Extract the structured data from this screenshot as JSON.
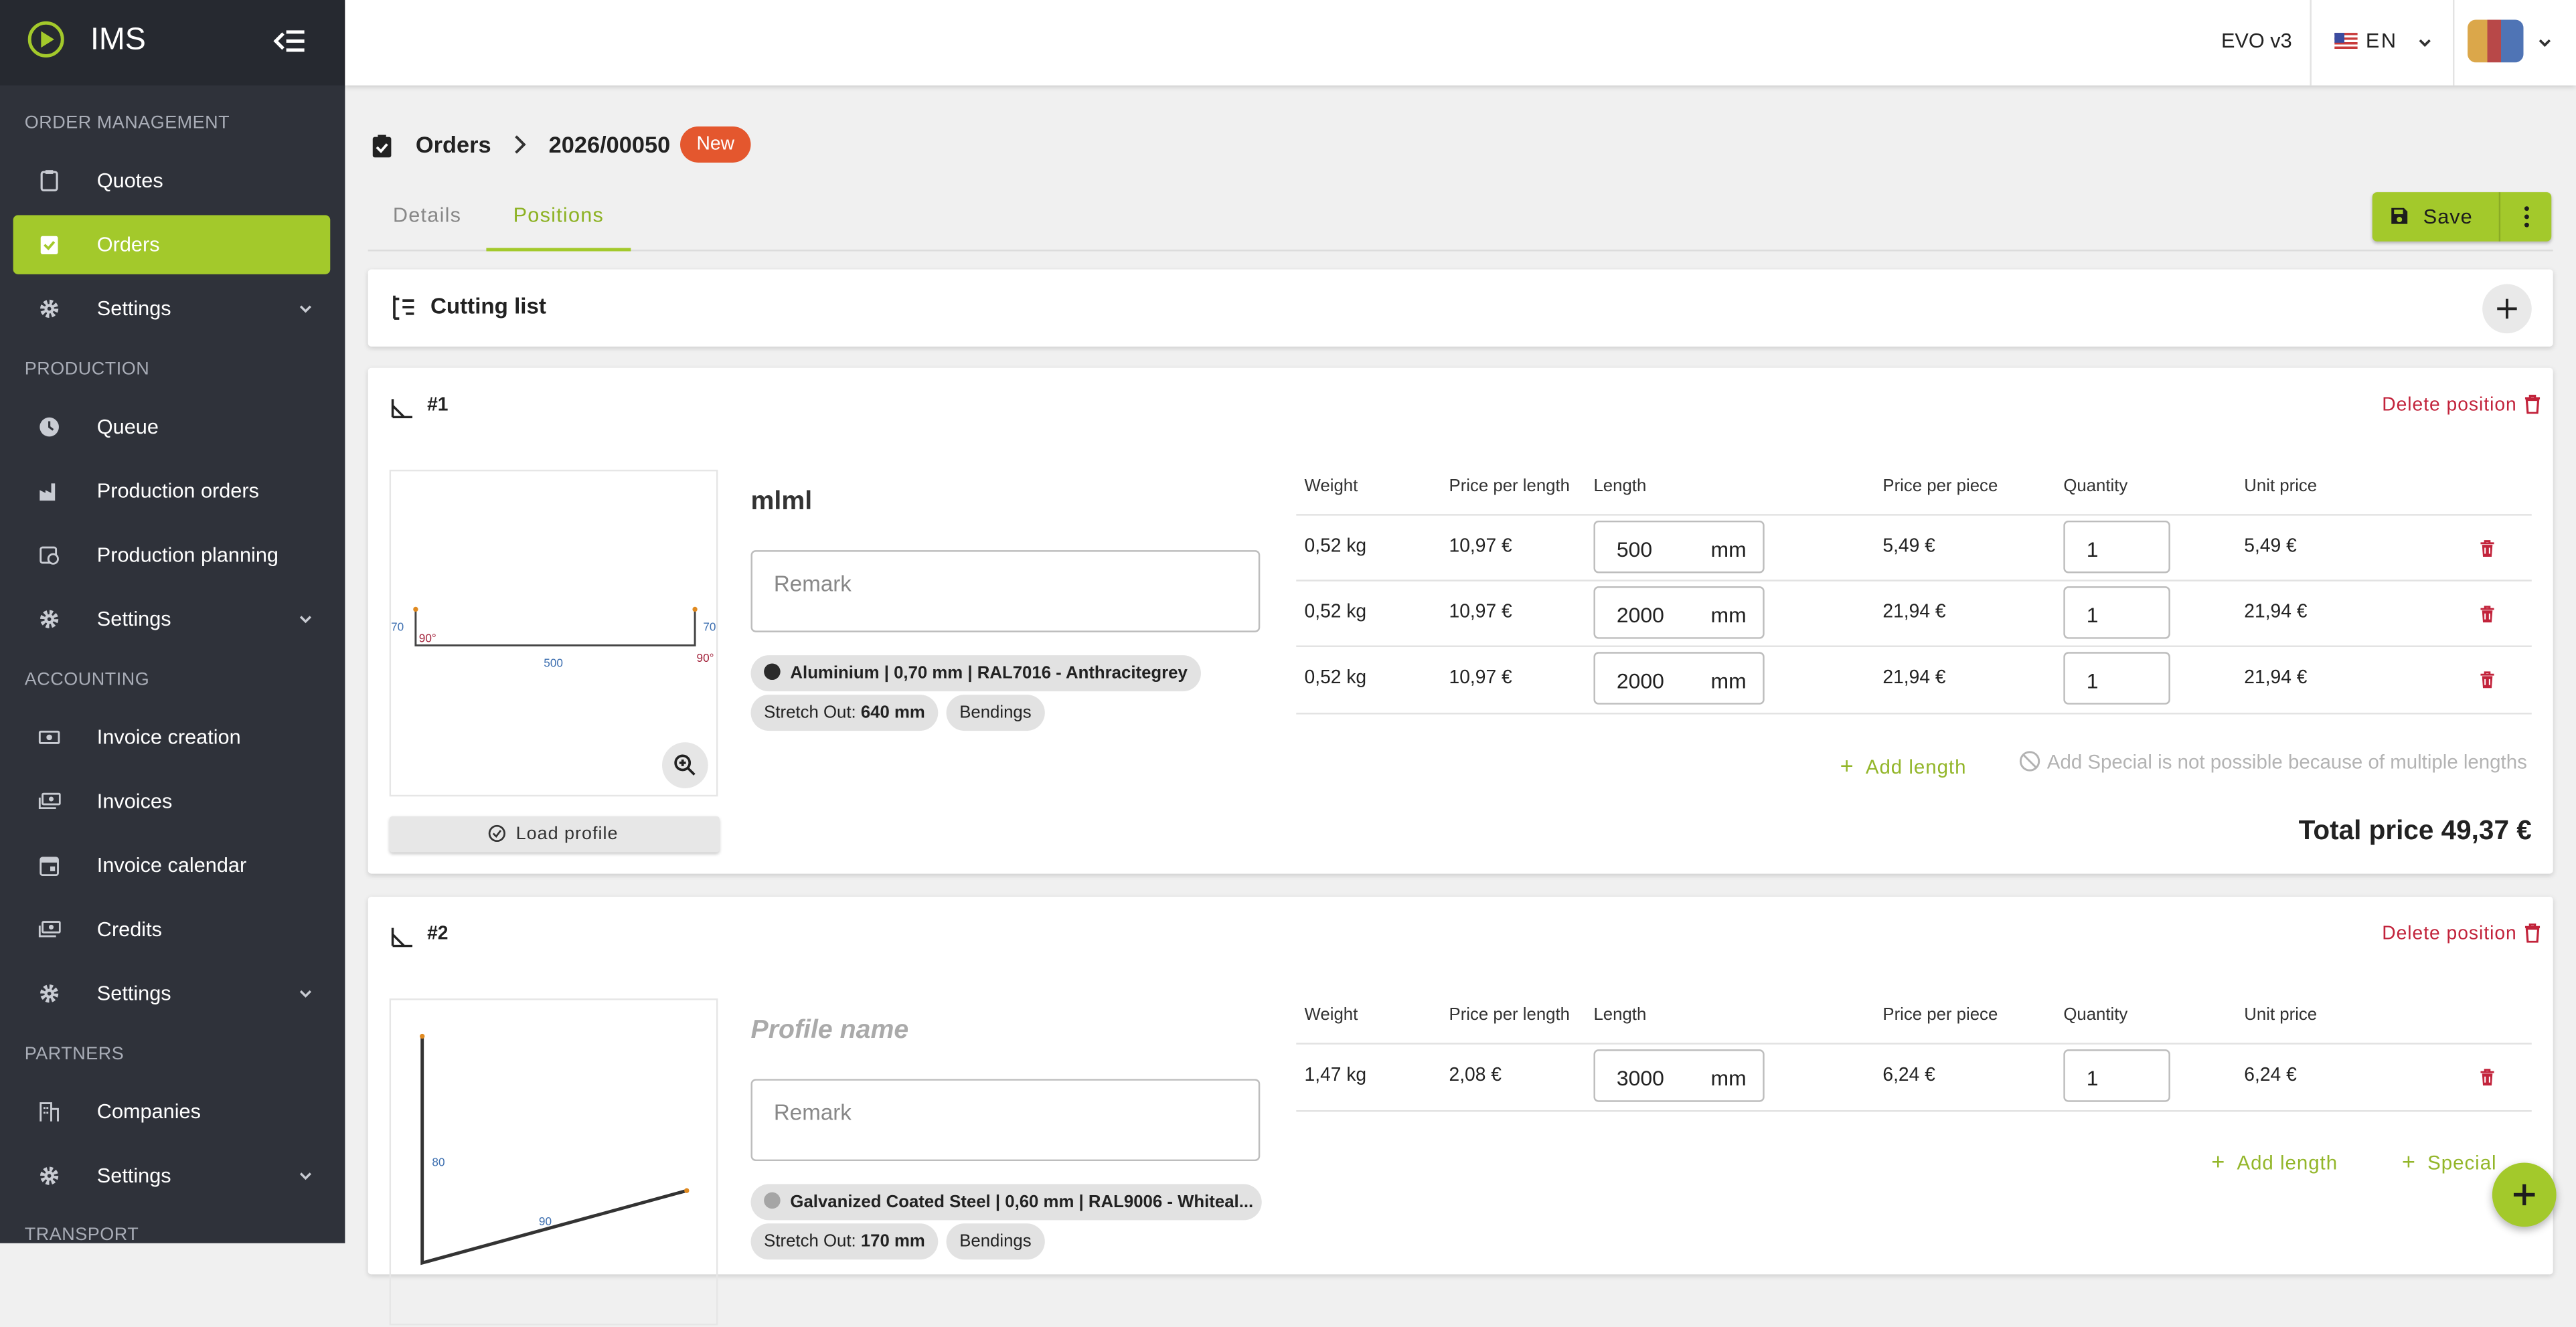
{
  "app": {
    "name": "IMS",
    "version": "EVO v3",
    "language": "EN",
    "accent_color": "#a3c92b",
    "danger_color": "#c2233b",
    "badge_color": "#e4572e"
  },
  "sidebar": {
    "sections": [
      "ORDER MANAGEMENT",
      "PRODUCTION",
      "ACCOUNTING",
      "PARTNERS",
      "TRANSPORT"
    ],
    "items": [
      {
        "label": "Quotes",
        "icon": "clipboard-icon"
      },
      {
        "label": "Orders",
        "icon": "clipboard-check-icon",
        "active": true
      },
      {
        "label": "Settings",
        "icon": "gear-icon"
      },
      {
        "label": "Queue",
        "icon": "clock-icon"
      },
      {
        "label": "Production orders",
        "icon": "factory-icon"
      },
      {
        "label": "Production planning",
        "icon": "calendar-clock-icon"
      },
      {
        "label": "Settings",
        "icon": "gear-icon"
      },
      {
        "label": "Invoice creation",
        "icon": "cash-icon"
      },
      {
        "label": "Invoices",
        "icon": "cash-multiple-icon"
      },
      {
        "label": "Invoice calendar",
        "icon": "calendar-icon"
      },
      {
        "label": "Credits",
        "icon": "cash-multiple-icon"
      },
      {
        "label": "Settings",
        "icon": "gear-icon"
      },
      {
        "label": "Companies",
        "icon": "office-building-icon"
      },
      {
        "label": "Settings",
        "icon": "gear-icon"
      }
    ]
  },
  "header": {
    "breadcrumb_root": "Orders",
    "order_number": "2026/00050",
    "status": "New"
  },
  "tabs": [
    "Details",
    "Positions"
  ],
  "toolbar": {
    "save_label": "Save"
  },
  "cutting_list": {
    "title": "Cutting list"
  },
  "columns": [
    "Weight",
    "Price per length",
    "Length",
    "Price per piece",
    "Quantity",
    "Unit price"
  ],
  "positions": [
    {
      "number": "#1",
      "delete_label": "Delete position",
      "load_profile_label": "Load profile",
      "profile_name": "mlml",
      "remark_placeholder": "Remark",
      "material": "Aluminium | 0,70 mm | RAL7016 - Anthracitegrey",
      "material_color": "#2b2b2b",
      "stretch_label": "Stretch Out:",
      "stretch_value": "640 mm",
      "bendings_label": "Bendings",
      "drawing_labels": {
        "left_height": "70",
        "right_height": "70",
        "width": "500",
        "left_angle": "90°",
        "right_angle": "90°"
      },
      "rows": [
        {
          "weight": "0,52 kg",
          "price_per_length": "10,97 €",
          "length": "500",
          "unit": "mm",
          "price_per_piece": "5,49 €",
          "quantity": "1",
          "unit_price": "5,49 €"
        },
        {
          "weight": "0,52 kg",
          "price_per_length": "10,97 €",
          "length": "2000",
          "unit": "mm",
          "price_per_piece": "21,94 €",
          "quantity": "1",
          "unit_price": "21,94 €"
        },
        {
          "weight": "0,52 kg",
          "price_per_length": "10,97 €",
          "length": "2000",
          "unit": "mm",
          "price_per_piece": "21,94 €",
          "quantity": "1",
          "unit_price": "21,94 €"
        }
      ],
      "add_length_label": "Add length",
      "special_note": "Add Special is not possible because of multiple lengths",
      "total": "Total price 49,37 €"
    },
    {
      "number": "#2",
      "delete_label": "Delete position",
      "profile_name_placeholder": "Profile name",
      "remark_placeholder": "Remark",
      "material": "Galvanized Coated Steel | 0,60 mm | RAL9006 - Whiteal...",
      "material_color": "#a5a5a5",
      "stretch_label": "Stretch Out:",
      "stretch_value": "170 mm",
      "bendings_label": "Bendings",
      "drawing_labels": {
        "height": "80",
        "angle": "90"
      },
      "rows": [
        {
          "weight": "1,47 kg",
          "price_per_length": "2,08 €",
          "length": "3000",
          "unit": "mm",
          "price_per_piece": "6,24 €",
          "quantity": "1",
          "unit_price": "6,24 €"
        }
      ],
      "add_length_label": "Add length",
      "special_label": "Special"
    }
  ]
}
